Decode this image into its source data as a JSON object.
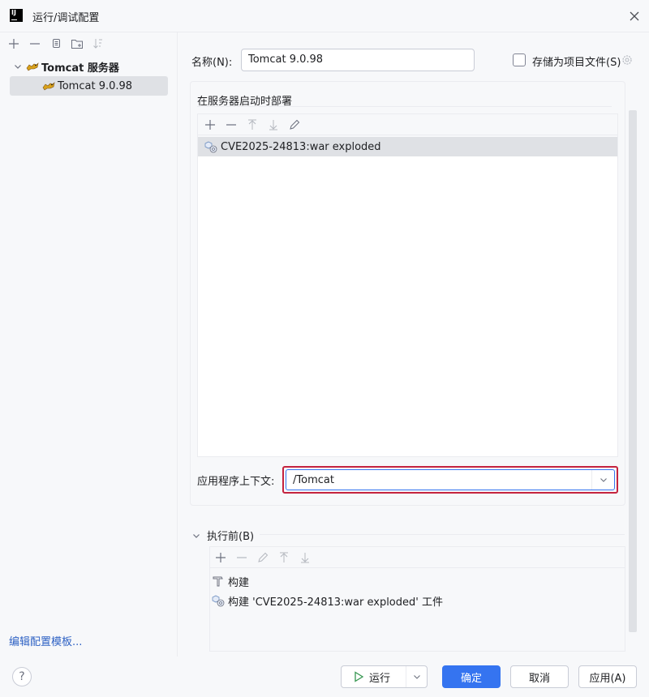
{
  "window": {
    "title": "运行/调试配置",
    "logo_text": "IJ"
  },
  "sidebar": {
    "toolbar": [
      "add-icon",
      "remove-icon",
      "copy-icon",
      "new-folder-icon",
      "sort-icon"
    ],
    "group_label": "Tomcat 服务器",
    "item_label": "Tomcat 9.0.98",
    "edit_templates_link": "编辑配置模板..."
  },
  "config": {
    "name_label": "名称(N):",
    "name_value": "Tomcat 9.0.98",
    "store_label": "存储为项目文件(S)",
    "store_checked": false
  },
  "deploy": {
    "section_title": "在服务器启动时部署",
    "artifacts": [
      "CVE2025-24813:war exploded"
    ],
    "context_label": "应用程序上下文:",
    "context_value": "/Tomcat"
  },
  "before_launch": {
    "label": "执行前(B)",
    "items": [
      "构建",
      "构建 'CVE2025-24813:war exploded' 工件"
    ]
  },
  "buttons": {
    "help": "?",
    "run": "运行",
    "ok": "确定",
    "cancel": "取消",
    "apply": "应用(A)"
  },
  "colors": {
    "accent": "#3574f0",
    "highlight_border": "#c4233f",
    "link": "#2f62c4",
    "selection": "#dfe1e5"
  }
}
